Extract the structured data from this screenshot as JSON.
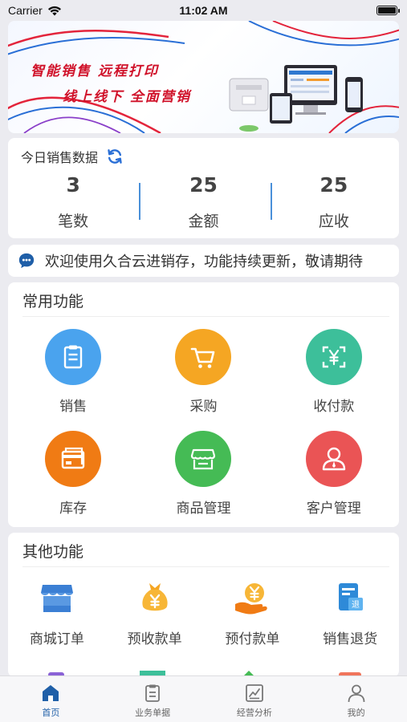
{
  "status_bar": {
    "carrier": "Carrier",
    "time": "11:02 AM"
  },
  "banner": {
    "line1": "智能销售 远程打印",
    "line2": "线上线下 全面营销"
  },
  "sales": {
    "title": "今日销售数据",
    "items": [
      {
        "value": "3",
        "label": "笔数"
      },
      {
        "value": "25",
        "label": "金额"
      },
      {
        "value": "25",
        "label": "应收"
      }
    ]
  },
  "notice": {
    "text": "欢迎使用久合云进销存，功能持续更新，敬请期待"
  },
  "common": {
    "title": "常用功能",
    "items": [
      {
        "label": "销售",
        "icon": "clipboard-icon",
        "color": "#4aa3ee"
      },
      {
        "label": "采购",
        "icon": "cart-icon",
        "color": "#f5a623"
      },
      {
        "label": "收付款",
        "icon": "yen-scan-icon",
        "color": "#3dbf9a"
      },
      {
        "label": "库存",
        "icon": "inventory-icon",
        "color": "#f07b14"
      },
      {
        "label": "商品管理",
        "icon": "store-icon",
        "color": "#45bb55"
      },
      {
        "label": "客户管理",
        "icon": "user-icon",
        "color": "#ea5455"
      }
    ]
  },
  "other": {
    "title": "其他功能",
    "items": [
      {
        "label": "商城订单",
        "icon": "shop-icon"
      },
      {
        "label": "预收款单",
        "icon": "money-bag-icon"
      },
      {
        "label": "预付款单",
        "icon": "hand-yen-icon"
      },
      {
        "label": "销售退货",
        "icon": "return-doc-icon"
      }
    ]
  },
  "tabbar": {
    "tabs": [
      {
        "label": "首页",
        "icon": "home-icon",
        "active": true
      },
      {
        "label": "业务单据",
        "icon": "document-icon",
        "active": false
      },
      {
        "label": "经营分析",
        "icon": "chart-icon",
        "active": false
      },
      {
        "label": "我的",
        "icon": "person-icon",
        "active": false
      }
    ]
  },
  "colors": {
    "accent": "#1f5fa8",
    "divider": "#4a90d9"
  }
}
